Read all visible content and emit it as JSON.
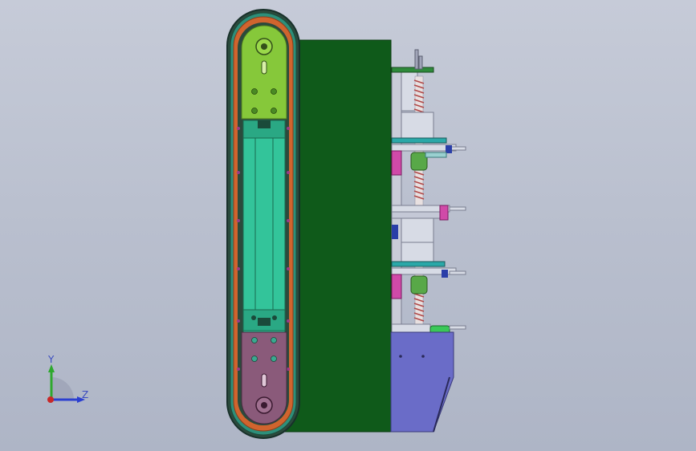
{
  "viewport": {
    "background_top": "#c6cbd8",
    "background_bottom": "#aeb5c6"
  },
  "colors": {
    "frame_green": "#0f5a1a",
    "top_plate": "#86c83a",
    "bottom_plate": "#8a5a7a",
    "rail_teal": "#33c49a",
    "chain_dark": "#2b4a3c",
    "belt_orange": "#d0642e",
    "base_purple": "#6a6cc8",
    "spring_red": "#b04848",
    "bracket_magenta": "#d04aa8",
    "fitting_blue": "#2a3ea8",
    "pale_gray": "#d7dbe5"
  },
  "triad": {
    "y_label": "Y",
    "z_label": "Z",
    "y_color": "#2ea82e",
    "z_color": "#2b3fd0",
    "origin_color": "#c82828"
  }
}
